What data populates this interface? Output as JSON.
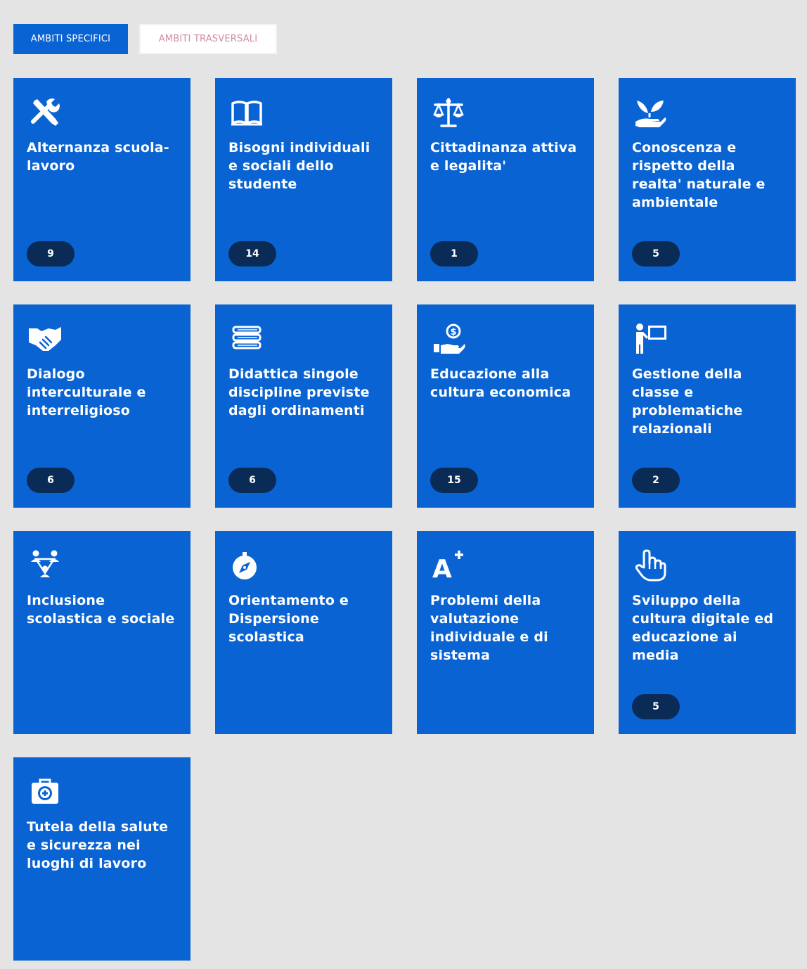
{
  "tabs": {
    "specific_label": "AMBITI SPECIFICI",
    "transversal_label": "AMBITI TRASVERSALI"
  },
  "colors": {
    "card": "#0a63d2",
    "badge": "#0b2b57",
    "page_background": "#e4e4e4",
    "inactive_tab_text": "#d28aa3"
  },
  "cards": [
    {
      "icon": "tools-icon",
      "title": "Alternanza scuola-lavoro",
      "count": "9"
    },
    {
      "icon": "book-icon",
      "title": "Bisogni individuali e sociali dello studente",
      "count": "14"
    },
    {
      "icon": "scales-icon",
      "title": "Cittadinanza attiva e legalita'",
      "count": "1"
    },
    {
      "icon": "plant-hand-icon",
      "title": "Conoscenza e rispetto della realta' naturale e ambientale",
      "count": "5"
    },
    {
      "icon": "handshake-icon",
      "title": "Dialogo interculturale e interreligioso",
      "count": "6"
    },
    {
      "icon": "books-stack-icon",
      "title": "Didattica singole discipline previste dagli ordinamenti",
      "count": "6"
    },
    {
      "icon": "money-hand-icon",
      "title": "Educazione alla cultura economica",
      "count": "15"
    },
    {
      "icon": "teacher-board-icon",
      "title": "Gestione della classe e problematiche relazionali",
      "count": "2"
    },
    {
      "icon": "people-network-icon",
      "title": "Inclusione scolastica e sociale",
      "count": ""
    },
    {
      "icon": "compass-icon",
      "title": "Orientamento e Dispersione scolastica",
      "count": ""
    },
    {
      "icon": "a-plus-icon",
      "title": "Problemi della valutazione individuale e di sistema",
      "count": ""
    },
    {
      "icon": "pointer-hand-icon",
      "title": "Sviluppo della cultura digitale ed educazione ai media",
      "count": "5"
    },
    {
      "icon": "first-aid-icon",
      "title": "Tutela della salute e sicurezza nei luoghi di lavoro",
      "count": ""
    }
  ]
}
